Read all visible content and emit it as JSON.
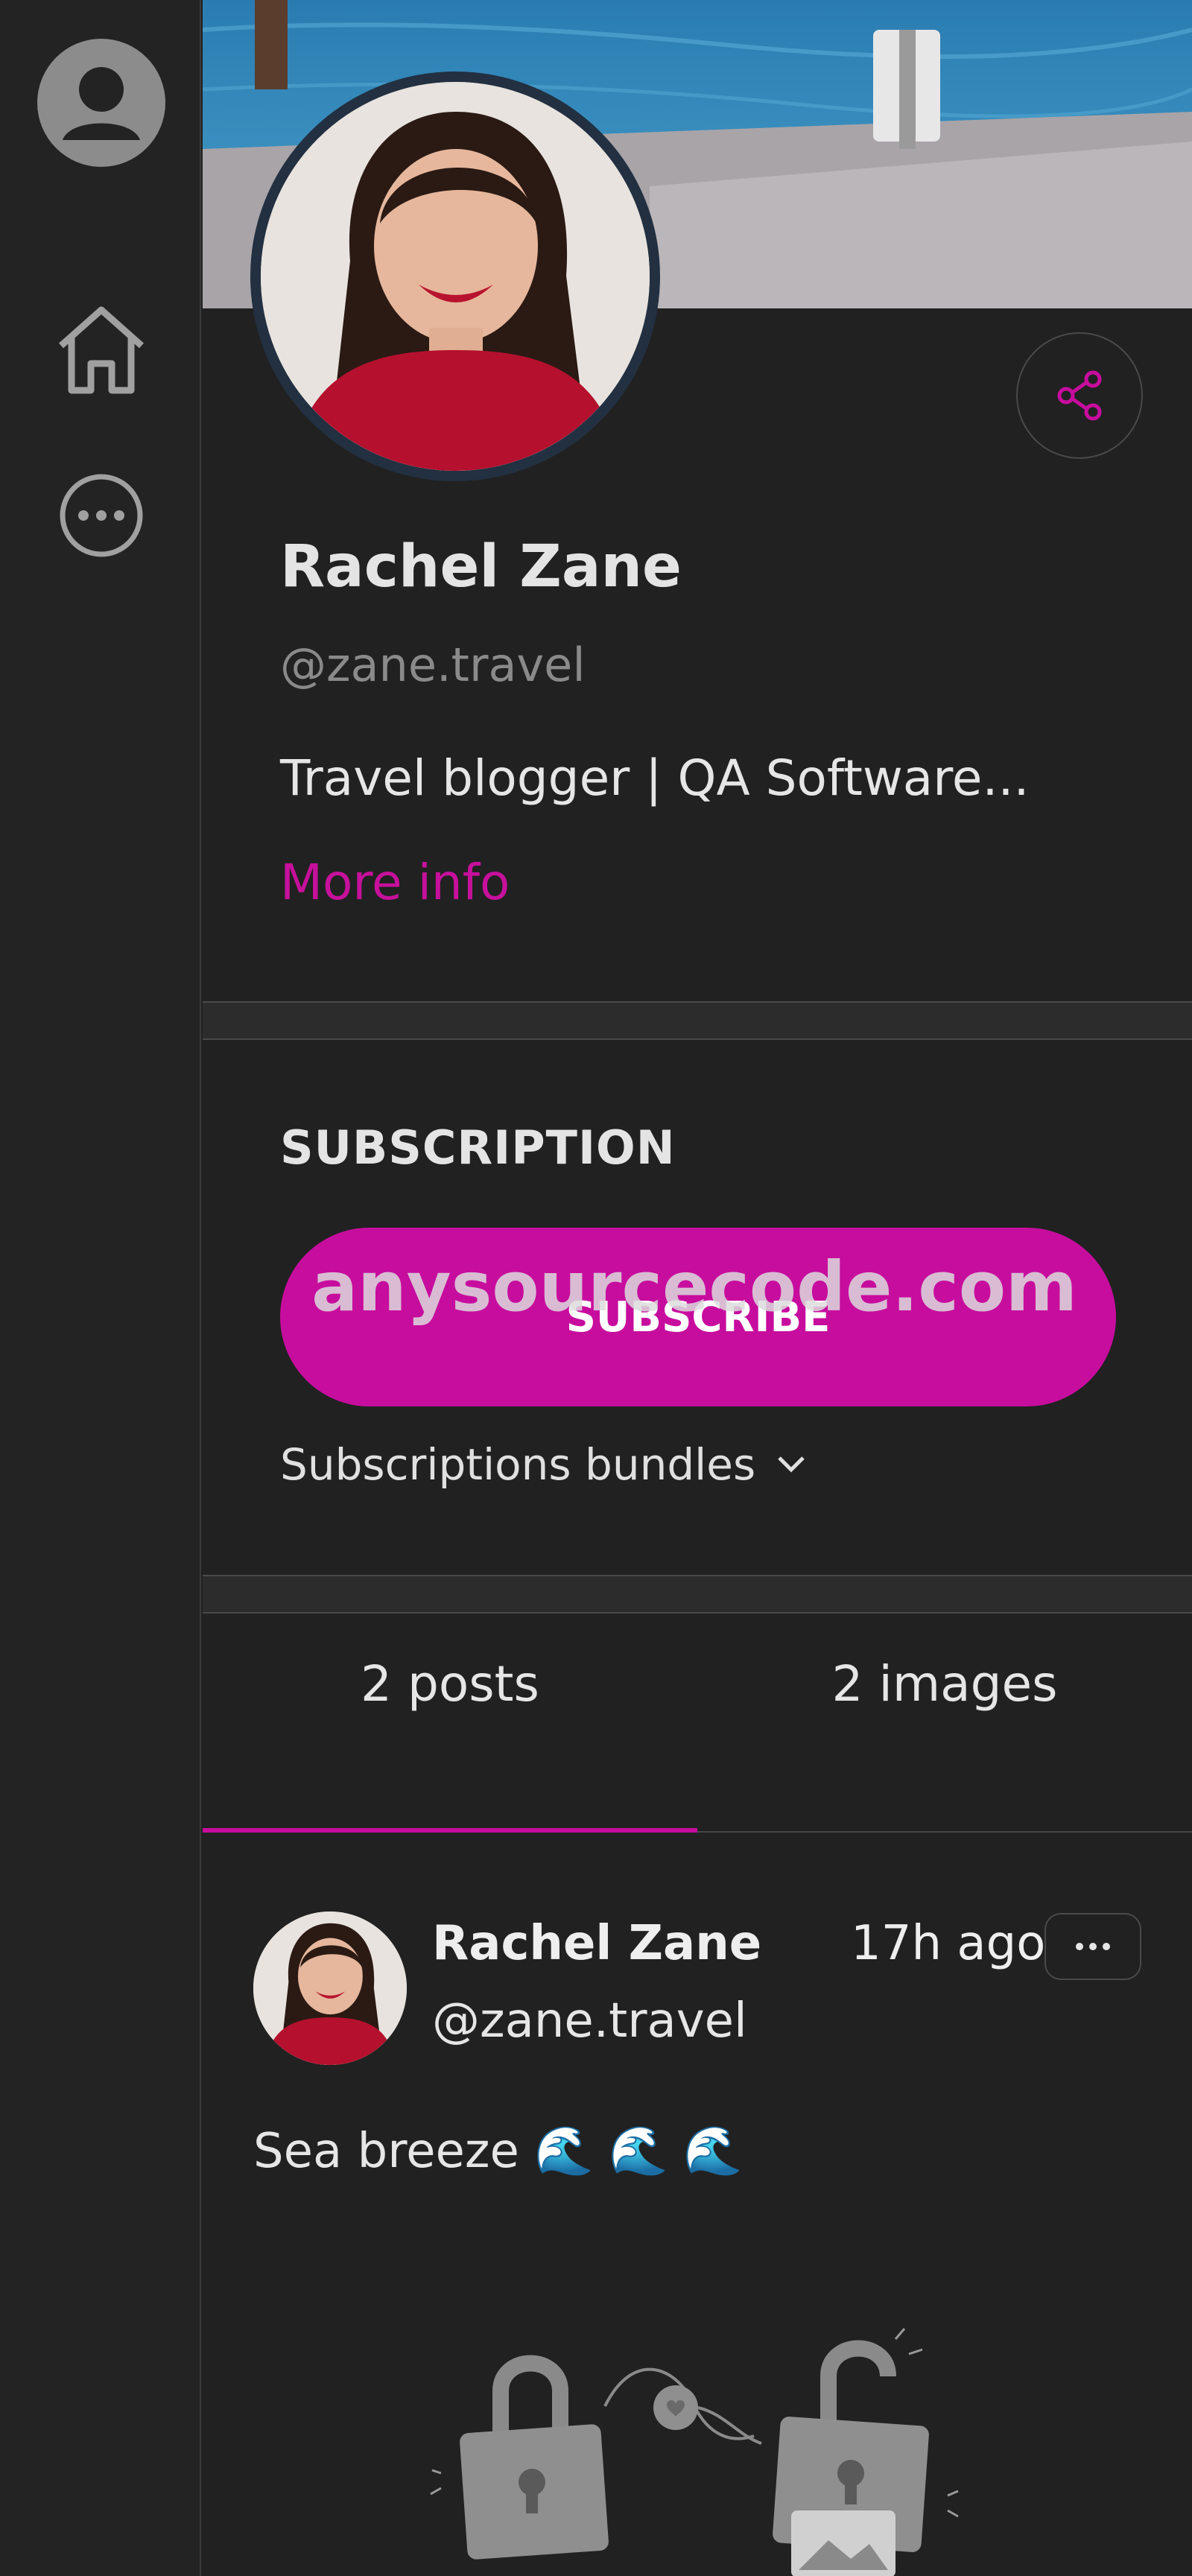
{
  "sidebar": {
    "items": [
      {
        "icon": "account-circle-icon"
      },
      {
        "icon": "home-icon"
      },
      {
        "icon": "more-horizontal-circle-icon"
      }
    ]
  },
  "profile": {
    "name": "Rachel Zane",
    "handle": "@zane.travel",
    "bio": "Travel blogger | QA Software...",
    "more_info": "More info",
    "share_icon": "share-icon"
  },
  "subscription": {
    "title": "SUBSCRIPTION",
    "button_label": "SUBSCRIBE",
    "bundles_label": "Subscriptions bundles",
    "watermark": "anysourcecode.com"
  },
  "tabs": [
    {
      "label": "2 posts",
      "active": true
    },
    {
      "label": "2 images",
      "active": false
    }
  ],
  "post": {
    "author_name": "Rachel Zane",
    "author_handle": "@zane.travel",
    "time": "17h ago",
    "text": "Sea breeze 🌊 🌊 🌊"
  },
  "colors": {
    "accent": "#c70d9e",
    "background": "#212121",
    "sidebar": "#232323",
    "muted_text": "#8a8a8a"
  }
}
